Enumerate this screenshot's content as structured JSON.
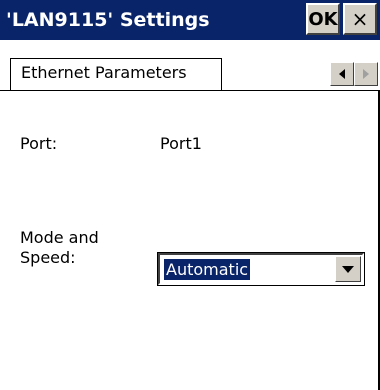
{
  "window": {
    "title": "'LAN9115' Settings",
    "ok_label": "OK",
    "close_label": "×"
  },
  "tabs": [
    {
      "label": "Ethernet Parameters",
      "selected": true
    }
  ],
  "tab_scroll": {
    "left_icon": "triangle-left-icon",
    "right_icon": "triangle-right-icon"
  },
  "fields": {
    "port": {
      "label": "Port:",
      "value": "Port1"
    },
    "mode_speed": {
      "label_line1": "Mode and",
      "label_line2": "Speed:",
      "selected": "Automatic"
    }
  },
  "colors": {
    "titlebar": "#0a246a",
    "selection": "#0a246a",
    "button_face": "#d4d0c8"
  }
}
